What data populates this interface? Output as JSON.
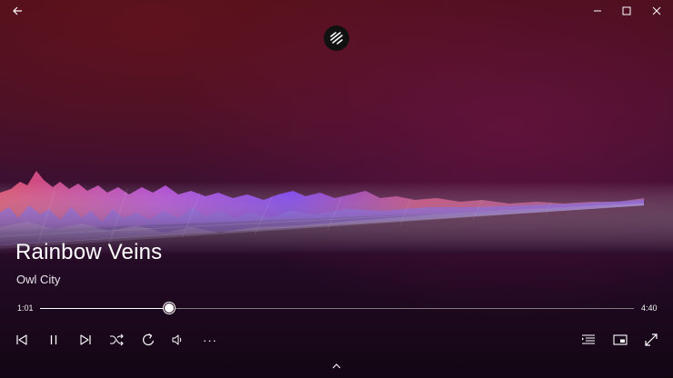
{
  "window": {
    "back": "back-arrow-icon",
    "minimize": "minimize-icon",
    "maximize": "maximize-icon",
    "close": "close-icon",
    "app_logo": "groove-music-logo-icon"
  },
  "now_playing": {
    "title": "Rainbow Veins",
    "artist": "Owl City"
  },
  "progress": {
    "elapsed": "1:01",
    "duration": "4:40",
    "fraction": 0.2179
  },
  "controls": {
    "previous": "previous-track-icon",
    "pause": "pause-icon",
    "next": "next-track-icon",
    "shuffle": "shuffle-icon",
    "repeat": "repeat-icon",
    "volume": "volume-icon",
    "more": "···",
    "playlist": "now-playing-list-icon",
    "mini_view": "mini-player-icon",
    "fullscreen": "fullscreen-icon",
    "expand": "chevron-up-icon"
  },
  "colors": {
    "accent": "#ffffff",
    "viz_left": "#e8456a",
    "viz_mid": "#8a3cf0",
    "viz_right": "#d24a8a"
  }
}
